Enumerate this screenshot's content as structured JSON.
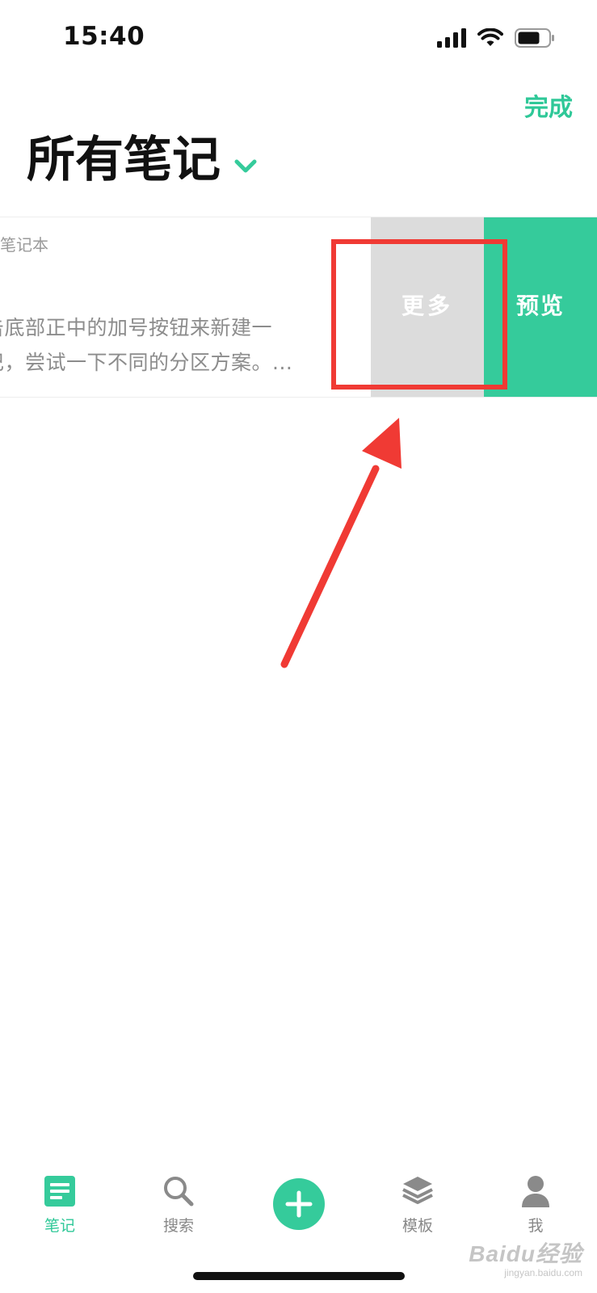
{
  "status_bar": {
    "time": "15:40",
    "icons": [
      "cellular-signal-icon",
      "wifi-icon",
      "battery-icon"
    ]
  },
  "header": {
    "done_label": "完成",
    "title": "所有笔记"
  },
  "note": {
    "notebook_text": "的笔记本",
    "line1": "击底部正中的加号按钮来新建一",
    "line2": "记，尝试一下不同的分区方案。..."
  },
  "swipe_actions": {
    "more_label": "更多",
    "preview_label": "预览"
  },
  "tab_bar": {
    "notes_label": "笔记",
    "search_label": "搜索",
    "templates_label": "模板",
    "me_label": "我"
  },
  "watermark": {
    "main": "Baidu经验",
    "sub": "jingyan.baidu.com"
  },
  "colors": {
    "accent": "#35cb9b",
    "more_bg": "#dcdcdc",
    "annotation": "#f03a34"
  }
}
